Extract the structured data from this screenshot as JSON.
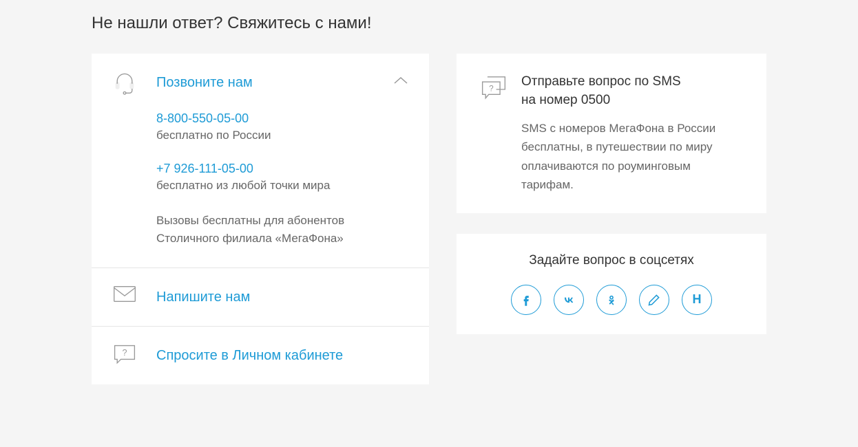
{
  "heading": "Не нашли ответ? Свяжитесь с нами!",
  "accordion": {
    "call": {
      "title": "Позвоните нам",
      "phone1": "8-800-550-05-00",
      "phone1_desc": "бесплатно по России",
      "phone2": "+7 926-111-05-00",
      "phone2_desc": "бесплатно из любой точки мира",
      "footnote": "Вызовы бесплатны для абонентов Столичного филиала «МегаФона»"
    },
    "write": {
      "title": "Напишите нам"
    },
    "ask": {
      "title": "Спросите в Личном кабинете"
    }
  },
  "sms": {
    "title_line1": "Отправьте вопрос по SMS",
    "title_line2": "на номер 0500",
    "desc": "SMS с номеров МегаФона в России бесплатны, в путешествии по миру оплачиваются по роуминговым тарифам."
  },
  "social": {
    "title": "Задайте вопрос в соцсетях",
    "items": [
      "facebook",
      "vkontakte",
      "odnoklassniki",
      "livejournal",
      "habr"
    ]
  }
}
